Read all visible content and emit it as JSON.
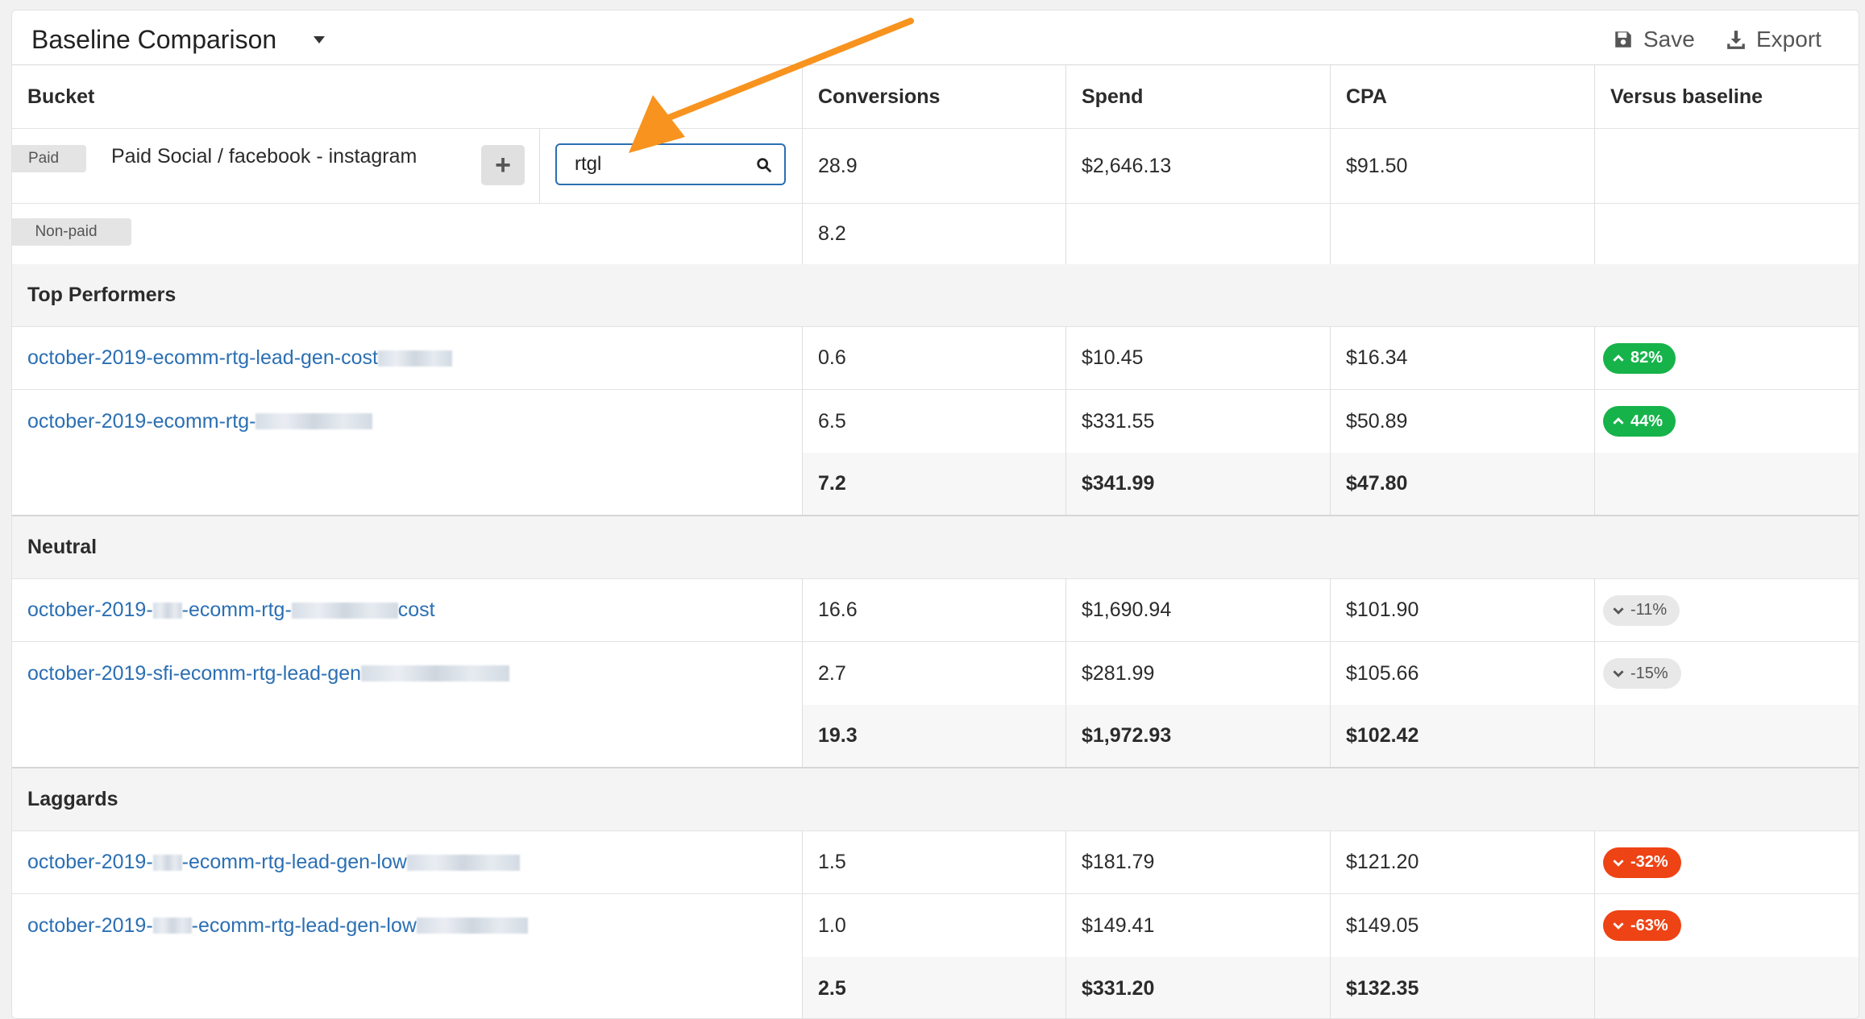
{
  "header": {
    "title": "Baseline Comparison",
    "save_label": "Save",
    "export_label": "Export"
  },
  "columns": {
    "bucket": "Bucket",
    "conversions": "Conversions",
    "spend": "Spend",
    "cpa": "CPA",
    "versus": "Versus baseline"
  },
  "paid_row": {
    "tag": "Paid",
    "name": "Paid Social / facebook - instagram",
    "search_value": "rtgl",
    "conversions": "28.9",
    "spend": "$2,646.13",
    "cpa": "$91.50"
  },
  "nonpaid_row": {
    "tag": "Non-paid",
    "conversions": "8.2"
  },
  "groups": [
    {
      "name": "Top Performers",
      "rows": [
        {
          "campaign": "october-2019-ecomm-rtg-lead-gen-cost",
          "conversions": "0.6",
          "spend": "$10.45",
          "cpa": "$16.34",
          "versus": "82%",
          "trend": "up"
        },
        {
          "campaign": "october-2019-ecomm-rtg-",
          "conversions": "6.5",
          "spend": "$331.55",
          "cpa": "$50.89",
          "versus": "44%",
          "trend": "up"
        }
      ],
      "total": {
        "conversions": "7.2",
        "spend": "$341.99",
        "cpa": "$47.80"
      }
    },
    {
      "name": "Neutral",
      "rows": [
        {
          "campaign_a": "october-2019-",
          "campaign_b": "-ecomm-rtg-",
          "campaign_c": "cost",
          "conversions": "16.6",
          "spend": "$1,690.94",
          "cpa": "$101.90",
          "versus": "-11%",
          "trend": "neutral"
        },
        {
          "campaign": "october-2019-sfi-ecomm-rtg-lead-gen",
          "conversions": "2.7",
          "spend": "$281.99",
          "cpa": "$105.66",
          "versus": "-15%",
          "trend": "neutral"
        }
      ],
      "total": {
        "conversions": "19.3",
        "spend": "$1,972.93",
        "cpa": "$102.42"
      }
    },
    {
      "name": "Laggards",
      "rows": [
        {
          "campaign_a": "october-2019-",
          "campaign_b": "-ecomm-rtg-lead-gen-low",
          "conversions": "1.5",
          "spend": "$181.79",
          "cpa": "$121.20",
          "versus": "-32%",
          "trend": "down"
        },
        {
          "campaign_a": "october-2019-",
          "campaign_b": "-ecomm-rtg-lead-gen-low",
          "conversions": "1.0",
          "spend": "$149.41",
          "cpa": "$149.05",
          "versus": "-63%",
          "trend": "down"
        }
      ],
      "total": {
        "conversions": "2.5",
        "spend": "$331.20",
        "cpa": "$132.35"
      }
    }
  ],
  "colors": {
    "link": "#2b6fb3",
    "up": "#16b34a",
    "down": "#ee4315",
    "neutral": "#e8e8e8",
    "annotation_arrow": "#f7931e"
  },
  "icons": {
    "save": "floppy-disk-icon",
    "export": "download-icon",
    "search": "magnifier-icon",
    "up": "chevron-up-icon",
    "down": "chevron-down-icon"
  }
}
